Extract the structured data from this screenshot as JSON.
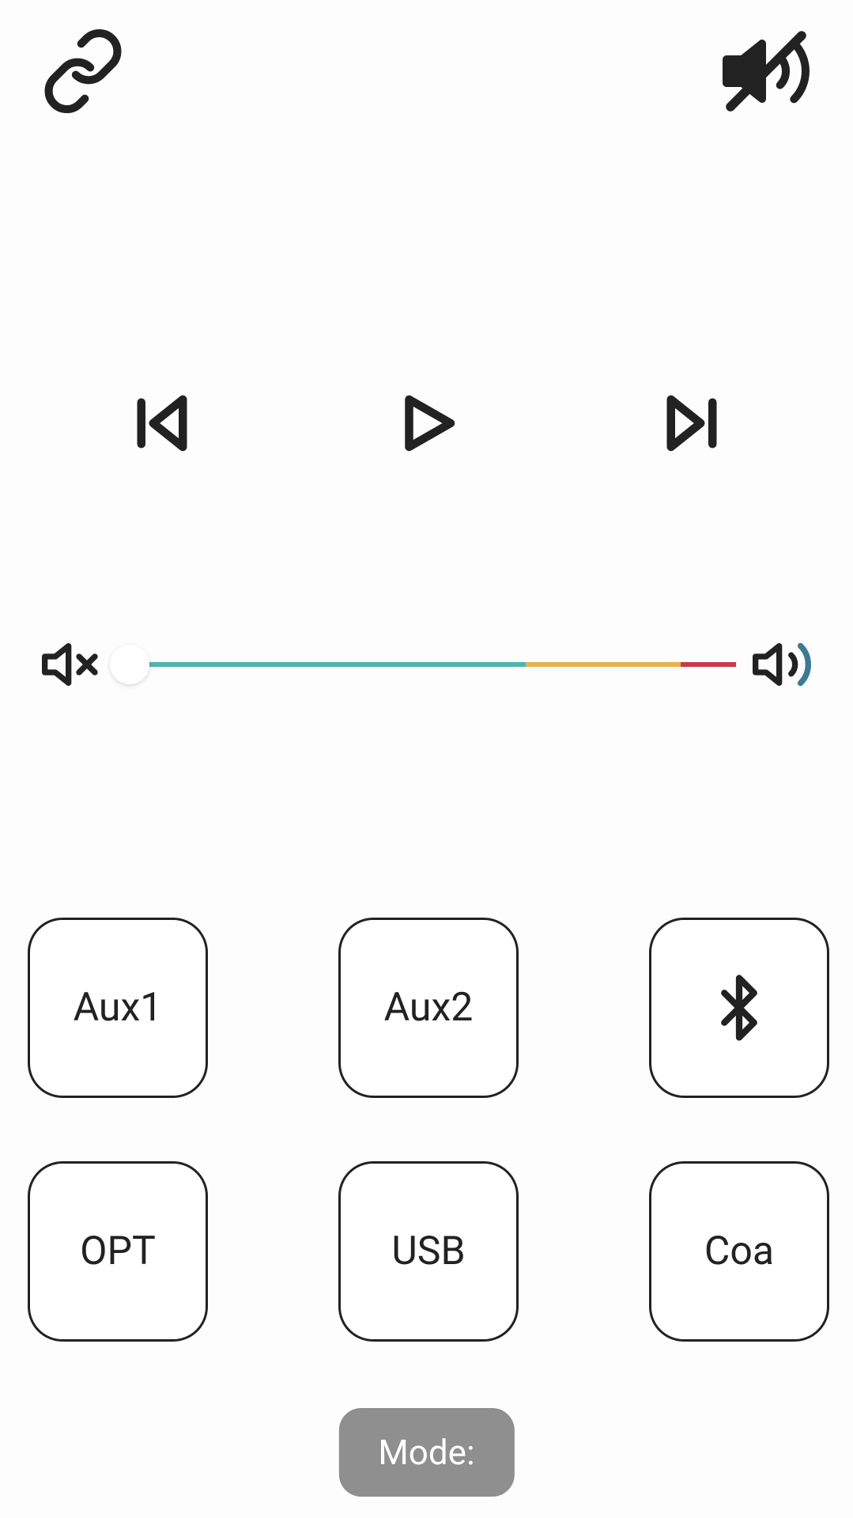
{
  "sources": {
    "aux1": "Aux1",
    "aux2": "Aux2",
    "opt": "OPT",
    "usb": "USB",
    "coa": "Coa"
  },
  "mode_label": "Mode:",
  "colors": {
    "stroke": "#222222",
    "teal": "#4db5b0",
    "yellow": "#e8b24a",
    "red": "#c93a4a",
    "mode_bg": "#8f8f8f"
  },
  "slider": {
    "value_percent": 0,
    "teal_width_pct": 66,
    "yellow_width_pct": 25,
    "red_width_pct": 9
  }
}
